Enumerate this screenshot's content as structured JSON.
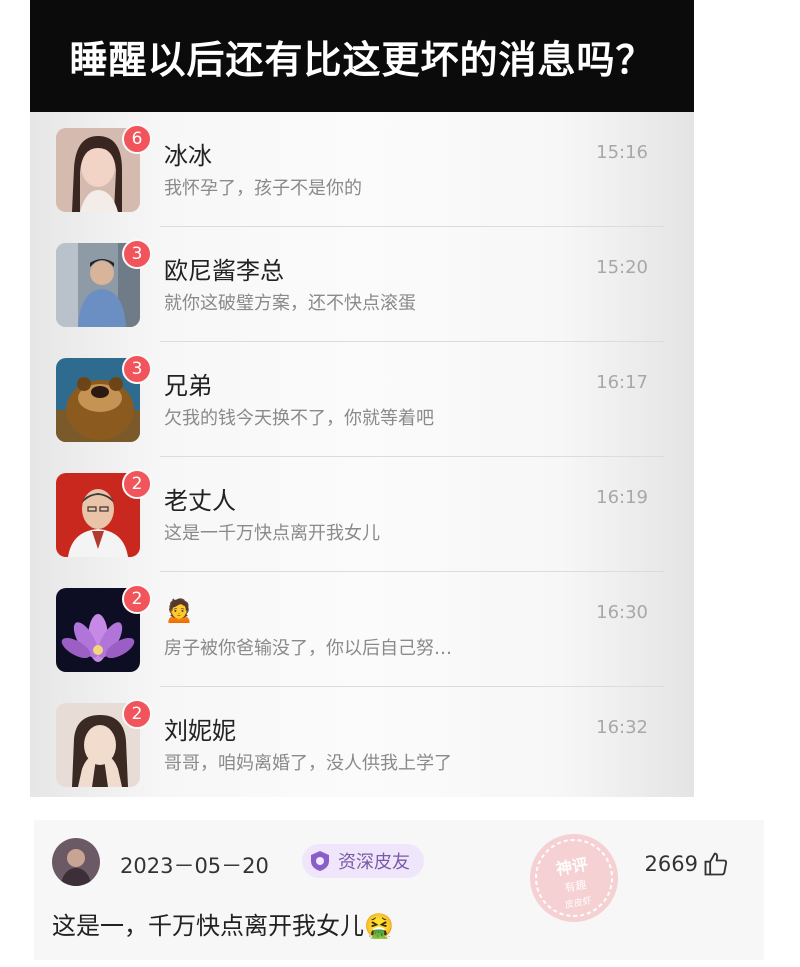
{
  "title": "睡醒以后还有比这更坏的消息吗？",
  "chats": [
    {
      "name": "冰冰",
      "message": "我怀孕了，孩子不是你的",
      "time": "15:16",
      "badge": "6"
    },
    {
      "name": "欧尼酱李总",
      "message": "就你这破璧方案，还不快点滚蛋",
      "time": "15:20",
      "badge": "3"
    },
    {
      "name": "兄弟",
      "message": "欠我的钱今天换不了，你就等着吧",
      "time": "16:17",
      "badge": "3"
    },
    {
      "name": "老丈人",
      "message": "这是一千万快点离开我女儿",
      "time": "16:19",
      "badge": "2"
    },
    {
      "name": "🙍",
      "message": "房子被你爸输没了，你以后自己努…",
      "time": "16:30",
      "badge": "2"
    },
    {
      "name": "刘妮妮",
      "message": "哥哥，咱妈离婚了，没人供我上学了",
      "time": "16:32",
      "badge": "2"
    }
  ],
  "comment": {
    "date": "2023－05－20",
    "user_badge": "资深皮友",
    "likes": "2669",
    "text": "这是一，千万快点离开我女儿🤮",
    "stamp_text": "神评 有趣 皮皮虾"
  },
  "colors": {
    "badge": "#f2545b",
    "title_bg": "#0b0b0b",
    "user_badge_bg": "#efe6fb"
  }
}
